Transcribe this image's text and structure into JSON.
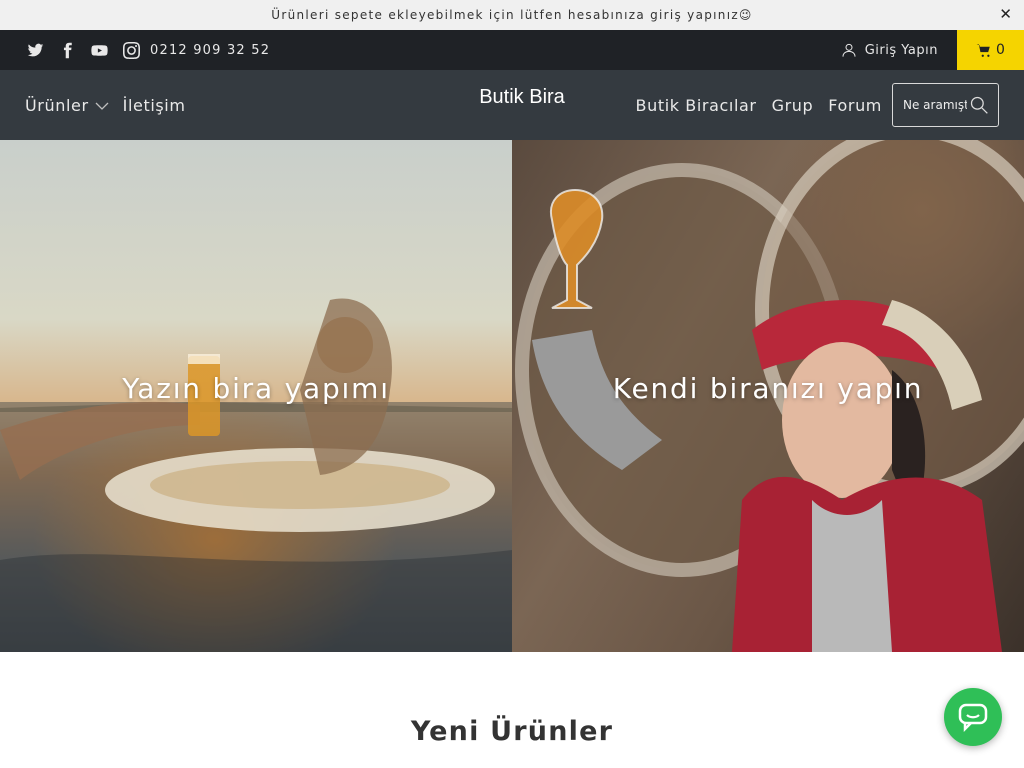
{
  "announcement": {
    "text": "Ürünleri sepete ekleyebilmek için lütfen hesabınıza giriş yapınız😉",
    "close_label": "✕"
  },
  "topbar": {
    "social_icons": [
      "twitter-icon",
      "facebook-icon",
      "youtube-icon",
      "instagram-icon"
    ],
    "phone": "0212 909 32 52",
    "login_label": "Giriş Yapın",
    "cart_count": "0",
    "cart_color": "#f5d400"
  },
  "nav": {
    "left_items": [
      {
        "label": "Ürünler",
        "has_dropdown": true
      },
      {
        "label": "İletişim"
      }
    ],
    "brand": "Butik Bira",
    "right_items": [
      {
        "label": "Butik Biracılar"
      },
      {
        "label": "Grup"
      },
      {
        "label": "Forum"
      }
    ],
    "search_placeholder": "Ne aramıştınız?"
  },
  "hero": {
    "panels": [
      {
        "caption": "Yazın bira yapımı"
      },
      {
        "caption": "Kendi biranızı yapın"
      }
    ]
  },
  "section": {
    "title": "Yeni Ürünler"
  },
  "colors": {
    "topbar_bg": "#1f2226",
    "nav_bg": "#343a40",
    "accent": "#f5d400",
    "chat": "#2fbf57"
  }
}
